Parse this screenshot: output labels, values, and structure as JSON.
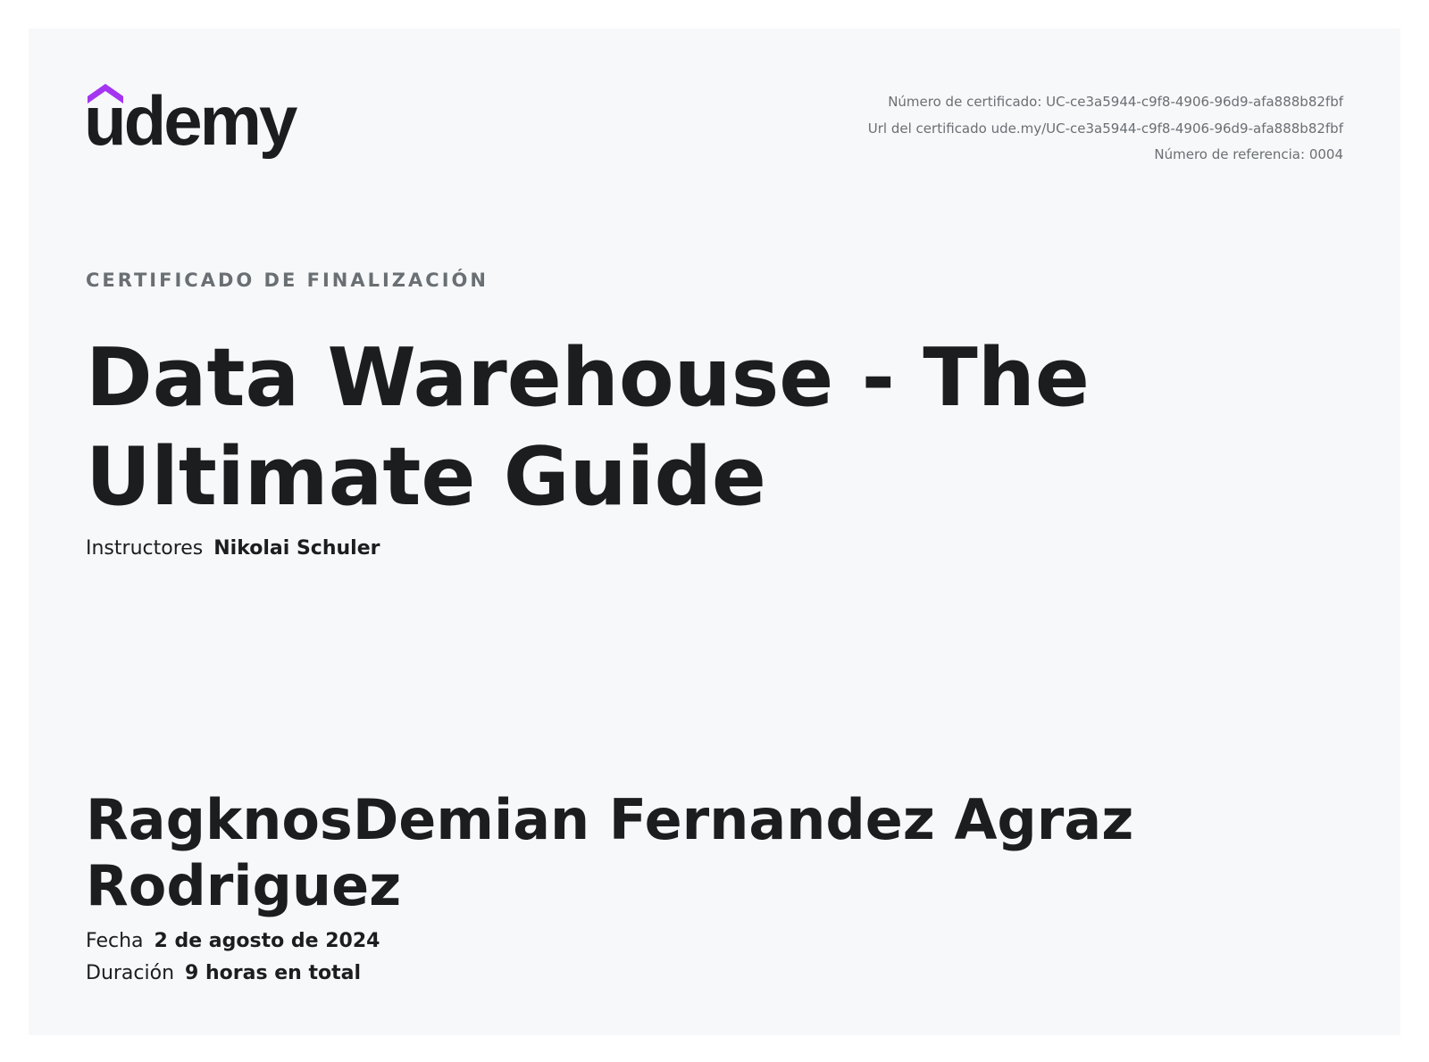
{
  "brand": {
    "logo_text": "udemy",
    "accent_color": "#a435f0"
  },
  "meta": {
    "certificate_number": "Número de certificado: UC-ce3a5944-c9f8-4906-96d9-afa888b82fbf",
    "certificate_url": "Url del certificado ude.my/UC-ce3a5944-c9f8-4906-96d9-afa888b82fbf",
    "reference_number": "Número de referencia: 0004"
  },
  "kicker": "CERTIFICADO DE FINALIZACIÓN",
  "course_title": "Data Warehouse - The Ultimate Guide",
  "instructors": {
    "label": "Instructores",
    "name": "Nikolai Schuler"
  },
  "recipient_name": "RagknosDemian Fernandez Agraz Rodriguez",
  "date": {
    "label": "Fecha",
    "value": "2 de agosto de 2024"
  },
  "duration": {
    "label": "Duración",
    "value": "9 horas en total"
  }
}
